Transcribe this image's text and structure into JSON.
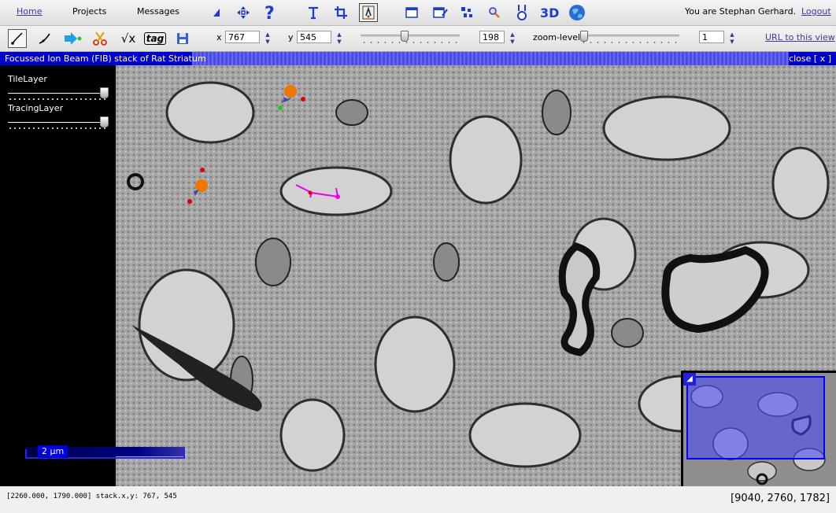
{
  "menu": {
    "home": "Home",
    "projects": "Projects",
    "messages": "Messages",
    "user_text": "You are Stephan Gerhard.",
    "logout": "Logout",
    "icons": [
      "navigate-back-icon",
      "move-icon",
      "help-icon",
      "text-tool-icon",
      "crop-icon",
      "tracing-tool-icon",
      "window-icon",
      "window-edit-icon",
      "segmentation-icon",
      "search-zoom-icon",
      "ontology-icon",
      "3d-view-icon",
      "globe-icon"
    ],
    "view_3d": "3D"
  },
  "toolbar": {
    "tools": [
      "tracing-pen-icon",
      "skeleton-pen-icon",
      "go-to-node-icon",
      "split-skeleton-icon",
      "math-sqrt-icon",
      "tag-icon",
      "save-icon"
    ],
    "sqrt_label": "√x",
    "tag_label": "tag",
    "x_label": "x",
    "x_value": "767",
    "y_label": "y",
    "y_value": "545",
    "z_value": "198",
    "z_slider_fraction": 0.44,
    "zoom_label": "zoom-level",
    "zoom_value": "1",
    "zoom_slider_fraction": 0.0,
    "url_link": "URL to this view"
  },
  "stack": {
    "title": "Focussed Ion Beam (FIB) stack of Rat Striatum",
    "close": "close [ x ]",
    "layers": [
      {
        "name": "TileLayer",
        "opacity": 1.0
      },
      {
        "name": "TracingLayer",
        "opacity": 1.0
      }
    ],
    "scale_label": "2 µm",
    "overview_toggle": "◢"
  },
  "status": {
    "left": "[2260.000, 1790.000] stack.x,y: 767, 545",
    "right": "[9040, 2760, 1782]"
  },
  "colors": {
    "title_bar": "#0000cc",
    "node_orange": "#ee7700",
    "node_red": "#dd0000",
    "node_green": "#22cc22",
    "skeleton_magenta": "#ee00ee"
  }
}
